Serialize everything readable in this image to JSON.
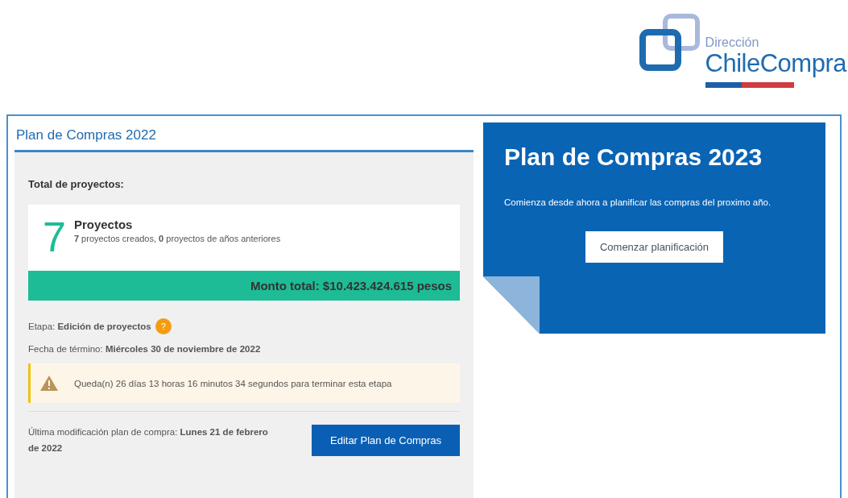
{
  "logo": {
    "line1": "Dirección",
    "line2": "ChileCompra"
  },
  "plan_2022": {
    "title": "Plan de Compras 2022",
    "total_label": "Total de proyectos:",
    "count": "7",
    "count_label": "Proyectos",
    "count_detail": "**7** proyectos creados, **0** proyectos de años anteriores",
    "amount": "Monto total: $10.423.424.615 pesos",
    "stage": "Etapa: **Edición de proyectos**",
    "help_badge": "?",
    "end_date": "Fecha de término: **Miércoles 30 de noviembre de 2022**",
    "warning": "Queda(n) 26 días 13 horas 16 minutos 34 segundos para terminar esta etapa",
    "last_modified": "Última modificación plan de compra: **Lunes 21 de febrero de 2022**",
    "edit_button": "Editar Plan de Compras"
  },
  "plan_2023": {
    "title": "Plan de Compras 2023",
    "text": "Comienza desde ahora a planificar las compras del proximo año.",
    "button": "Comenzar planificación"
  }
}
